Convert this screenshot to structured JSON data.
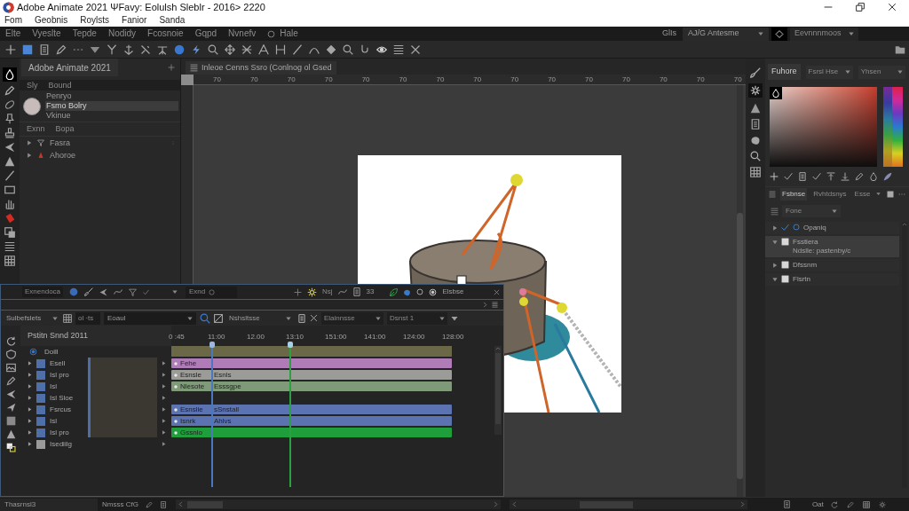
{
  "window": {
    "title": "Adobe Animate 2021 ΨFavy: Eolulsh Sleblr - 2016> 2220"
  },
  "app_menu": [
    "Fom",
    "Geobnis",
    "Roylsts",
    "Fanior",
    "Sanda"
  ],
  "menu": [
    "Elte",
    "Vyeslte",
    "Tepde",
    "Nodidy",
    "Fcosnoie",
    "Gqpd",
    "Nvnefv",
    "Hale"
  ],
  "workspace": {
    "label": "GlIs",
    "preset": "AJ/G Antesme",
    "search": "Eevnnnmoos"
  },
  "library_panel": {
    "tab": "Adobe Animate 2021",
    "header": [
      "Sly",
      "Bound"
    ],
    "entry": [
      {
        "text": "Penryo",
        "selected": false
      },
      {
        "text": "Fsmo Bolry",
        "selected": true
      },
      {
        "text": "Vkinue",
        "selected": false
      }
    ],
    "section": [
      "Exnn",
      "Bopa"
    ],
    "tree": [
      {
        "label": "Fasra",
        "expanded": false
      },
      {
        "label": "Ahoroe",
        "expanded": false
      }
    ]
  },
  "stage": {
    "tab": "Inleoe Cenns Ssro (Conlnog ol Gsed",
    "ruler_labels": [
      "70",
      "70",
      "70",
      "70",
      "70",
      "70",
      "70",
      "70",
      "70",
      "70",
      "70",
      "70",
      "70",
      "70",
      "70"
    ]
  },
  "timeline": {
    "footer_label": "Exnendoca",
    "scene": "Exnd",
    "frame_label": "Nsj",
    "counter": "33",
    "panel_label": "Elsbse",
    "toolbar": {
      "filter": "Sulbefslets",
      "field_prefix": "ol ·ts",
      "layer_dropdown": "Eoaul",
      "mode_dropdown": "Nshsltsse",
      "view_dropdown": "Elainnsse",
      "scene_dropdown": "Dsnst 1"
    },
    "title": "Pstitn Snnd 2011",
    "time_labels": [
      "0 :45",
      "11:00",
      "12.00",
      "13:10",
      "151:00",
      "141:00",
      "124:00",
      "128:00"
    ],
    "folder": "Doill",
    "layers": [
      {
        "name": "Esell",
        "color": "#4f6fa8",
        "clip": {
          "label": "Fehe",
          "color": "#b07cb8"
        }
      },
      {
        "name": "Isl pro",
        "color": "#4f6fa8",
        "clip": {
          "label": "Esnsle",
          "label_2": "Esnls",
          "color": "#9b9b98"
        }
      },
      {
        "name": "Isl",
        "color": "#4f6fa8",
        "clip": {
          "label": "Nlesote",
          "label_2": "Esssgpe",
          "color": "#7e9a78"
        }
      },
      {
        "name": "Isl Sloe",
        "color": "#4f6fa8"
      },
      {
        "name": "Fsrcus",
        "color": "#4f6fa8",
        "clip": {
          "label": "Esnslie",
          "label_2": "sSnstall",
          "color": "#5b73b0"
        }
      },
      {
        "name": "Isl",
        "color": "#4f6fa8",
        "clip": {
          "label": "Isnrk",
          "label_2": "Ahlvs",
          "color": "#5b73b0"
        }
      },
      {
        "name": "Isl pro",
        "color": "#4f6fa8",
        "clip": {
          "label": "Gssnlo",
          "color": "#1f9f3c"
        }
      },
      {
        "name": "Isediilg",
        "color": "#9a9a9a"
      }
    ]
  },
  "properties_panel": {
    "tabs": [
      {
        "label": "Fuhore",
        "selected": true
      }
    ],
    "dropdowns": [
      "Fsrsl Hse",
      "Yhsen"
    ]
  },
  "layers_panel": {
    "tabs": [
      {
        "label": "Fsbnse",
        "selected": true
      },
      {
        "label": "Rvhtdsnys",
        "selected": false
      },
      {
        "label": "Esse",
        "selected": false
      }
    ],
    "filter": "Fone",
    "tree": [
      {
        "label": "Opaniq",
        "checked": true,
        "expanded": false,
        "selected": false
      },
      {
        "label": "Fsstiera",
        "detail": "Ndslle: pastenby/c",
        "checked": false,
        "expanded": true,
        "selected": true
      },
      {
        "label": "Dfssnm",
        "checked": false,
        "expanded": false,
        "selected": false
      },
      {
        "label": "Flsrtn",
        "checked": false,
        "expanded": true,
        "selected": false
      }
    ]
  },
  "status_bar": {
    "left": "Thasrnsl3",
    "center": "Nmsss CfG",
    "right": "Oat"
  }
}
